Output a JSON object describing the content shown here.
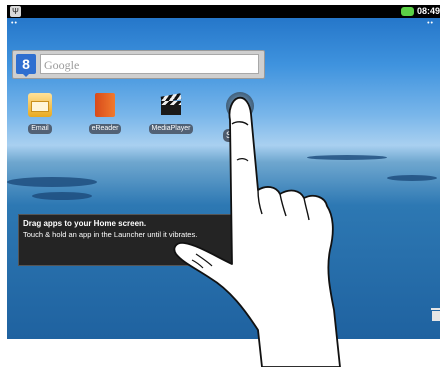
{
  "status_bar": {
    "time": "08:49",
    "usb_icon": "usb-debug-icon",
    "battery_icon": "battery-icon",
    "battery_color": "#5bd046"
  },
  "search": {
    "badge": "8",
    "placeholder": "Google"
  },
  "apps": [
    {
      "label": "Email",
      "icon": "email-icon"
    },
    {
      "label": "eReader",
      "icon": "ereader-icon"
    },
    {
      "label": "MediaPlayer",
      "icon": "mediaplayer-icon"
    },
    {
      "label": "Se",
      "icon": "settings-icon"
    }
  ],
  "toast": {
    "title": "Drag apps to your Home screen.",
    "body": "Touch & hold an app in the Launcher until it vibrates."
  },
  "trash_icon": "trash-icon",
  "overlay": "pointing-hand"
}
